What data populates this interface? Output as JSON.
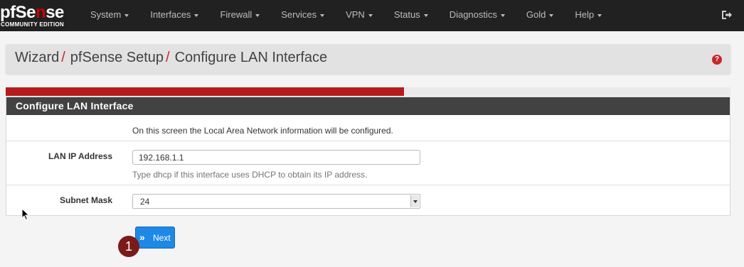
{
  "brand": {
    "logo_text_pre": "pf",
    "logo_text_mid": "Se",
    "logo_text_red": "n",
    "logo_text_post": "se",
    "logo_subtitle": "COMMUNITY EDITION"
  },
  "nav": {
    "items": [
      {
        "label": "System"
      },
      {
        "label": "Interfaces"
      },
      {
        "label": "Firewall"
      },
      {
        "label": "Services"
      },
      {
        "label": "VPN"
      },
      {
        "label": "Status"
      },
      {
        "label": "Diagnostics"
      },
      {
        "label": "Gold"
      },
      {
        "label": "Help"
      }
    ],
    "logout_icon": "sign-out-icon"
  },
  "breadcrumb": {
    "items": [
      "Wizard",
      "pfSense Setup",
      "Configure LAN Interface"
    ],
    "separator": "/",
    "help_icon": "question-circle-icon"
  },
  "progress": {
    "percent": 55
  },
  "panel": {
    "title": "Configure LAN Interface",
    "intro": "On this screen the Local Area Network information will be configured.",
    "lan_ip": {
      "label": "LAN IP Address",
      "value": "192.168.1.1",
      "help": "Type dhcp if this interface uses DHCP to obtain its IP address."
    },
    "subnet": {
      "label": "Subnet Mask",
      "value": "24"
    }
  },
  "next_button": {
    "label": "Next",
    "icon": "double-chevron-right-icon"
  },
  "annotation_badge": {
    "text": "1"
  },
  "colors": {
    "navbar": "#212121",
    "accent_red": "#b71c1c",
    "button_blue": "#1e88e5",
    "panel_heading": "#424242"
  }
}
